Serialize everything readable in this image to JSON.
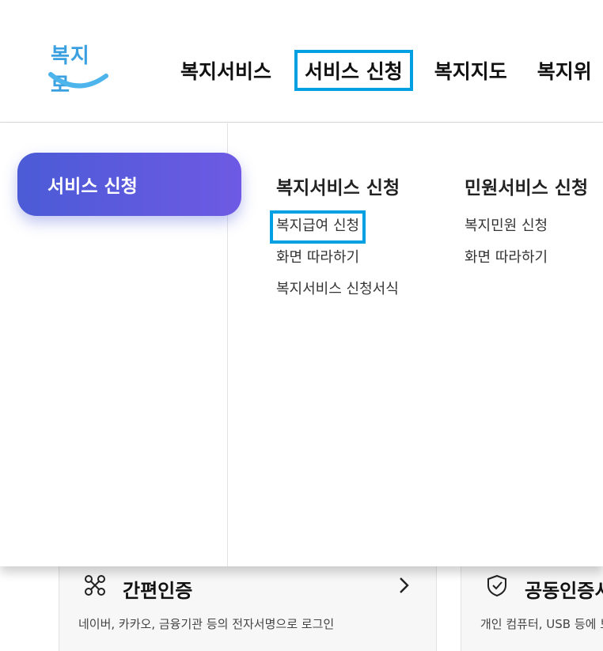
{
  "logo": {
    "text": "복지로"
  },
  "gnb": {
    "items": [
      {
        "label": "복지서비스",
        "active": false
      },
      {
        "label": "서비스 신청",
        "active": true
      },
      {
        "label": "복지지도",
        "active": false
      },
      {
        "label": "복지위",
        "active": false
      }
    ]
  },
  "panel": {
    "side_title": "서비스 신청",
    "columns": [
      {
        "title": "복지서비스 신청",
        "links": [
          {
            "label": "복지급여 신청",
            "active": true
          },
          {
            "label": "화면 따라하기",
            "active": false
          },
          {
            "label": "복지서비스 신청서식",
            "active": false
          }
        ]
      },
      {
        "title": "민원서비스 신청",
        "links": [
          {
            "label": "복지민원 신청",
            "active": false
          },
          {
            "label": "화면 따라하기",
            "active": false
          }
        ]
      }
    ]
  },
  "cards": [
    {
      "title": "간편인증",
      "desc": "네이버, 카카오, 금융기관 등의 전자서명으로 로그인",
      "icon": "network-icon"
    },
    {
      "title": "공동인증서",
      "desc": "개인 컴퓨터, USB 등에 보",
      "icon": "shield-check-icon"
    }
  ],
  "colors": {
    "accent_outline": "#00a0e3",
    "pill_start": "#4b5bd6",
    "pill_end": "#6e5ae4",
    "logo": "#3aa0e0"
  }
}
